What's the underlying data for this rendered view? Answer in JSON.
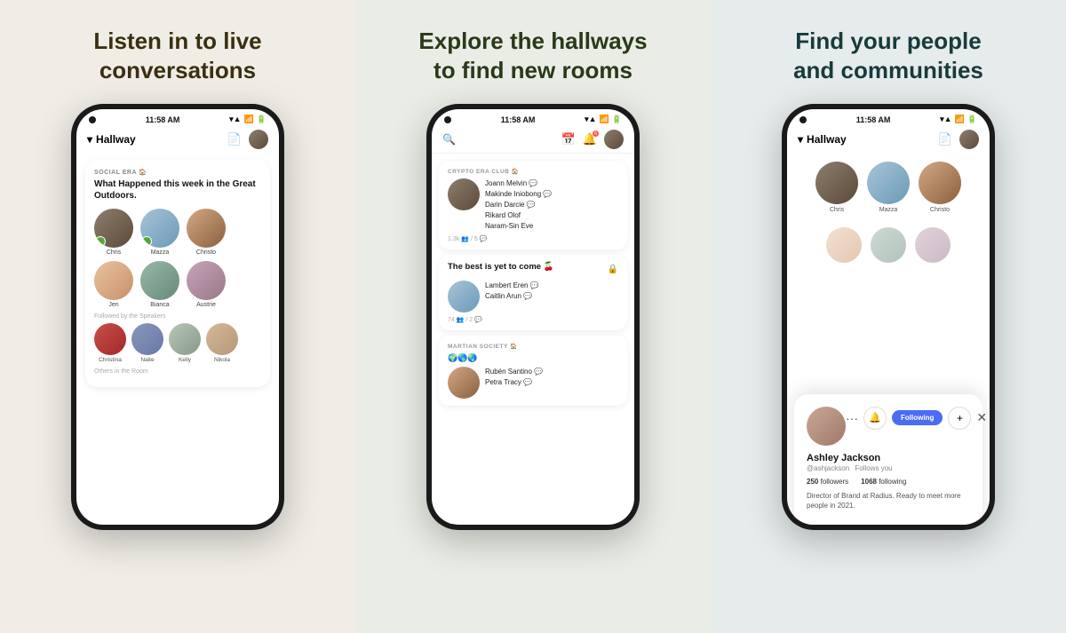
{
  "panels": [
    {
      "id": "panel-1",
      "title": "Listen in to live\nconversations",
      "bg": "#f0ede6",
      "titleColor": "#3a3010",
      "phone": {
        "time": "11:58 AM",
        "header": {
          "label": "Hallway",
          "hasDropdown": true
        },
        "room": {
          "club": "SOCIAL ERA 🏠",
          "title": "What Happened this week in the Great Outdoors.",
          "speakers": [
            {
              "name": "Chris",
              "badge": "🌿"
            },
            {
              "name": "Mazza",
              "badge": "🌿"
            },
            {
              "name": "Christo",
              "badge": ""
            }
          ],
          "row2": [
            {
              "name": "Jen",
              "badge": ""
            },
            {
              "name": "Bianca",
              "badge": ""
            },
            {
              "name": "Austrie",
              "badge": ""
            }
          ],
          "followedLabel": "Followed by the Speakers",
          "followed": [
            {
              "name": "Christina"
            },
            {
              "name": "Naite"
            },
            {
              "name": "Kelly"
            },
            {
              "name": "Nikola"
            }
          ],
          "othersLabel": "Others in the Room"
        }
      }
    },
    {
      "id": "panel-2",
      "title": "Explore the hallways\nto find new rooms",
      "bg": "#eaede6",
      "titleColor": "#2a3a18",
      "phone": {
        "time": "11:58 AM",
        "notifCount": "6",
        "rooms": [
          {
            "club": "CRYPTO ERA CLUB 🏠",
            "title": "",
            "speakers_names": [
              "Joann Melvin 💬",
              "Makinde Iniobong 💬",
              "Darin Darcie 💬",
              "Rikard Olof",
              "Naram-Sin Eve"
            ],
            "stats": "1.3k 👥 / 5 💬"
          },
          {
            "club": "",
            "title": "The best is yet to come 🍒",
            "locked": true,
            "speakers_names": [
              "Lambert Eren 💬",
              "Caitlin Arun 💬"
            ],
            "stats": "74 👥 / 2 💬"
          },
          {
            "club": "MARTIAN SOCIETY 🏠",
            "title": "",
            "emojis": "🌍🌎🌏",
            "speakers_names": [
              "Rubén Santino 💬",
              "Petra Tracy 💬"
            ],
            "stats": ""
          }
        ]
      }
    },
    {
      "id": "panel-3",
      "title": "Find your people\nand communities",
      "bg": "#e6ebec",
      "titleColor": "#183a3a",
      "phone": {
        "time": "11:58 AM",
        "header": {
          "label": "Hallway",
          "hasDropdown": true
        },
        "topAvatars": [
          {
            "name": "Chris"
          },
          {
            "name": "Mazza"
          },
          {
            "name": "Christo"
          }
        ],
        "popup": {
          "name": "Ashley Jackson",
          "handle": "@ashjackson",
          "followsYou": "Follows you",
          "followers": "250",
          "followersLabel": "followers",
          "following": "1068",
          "followingLabel": "following",
          "bio": "Director of Brand at Radius. Ready to meet more people in 2021.",
          "followBtn": "Following",
          "bellIcon": "🔔",
          "addIcon": "+",
          "dotsIcon": "···",
          "closeIcon": "✕"
        }
      }
    }
  ]
}
